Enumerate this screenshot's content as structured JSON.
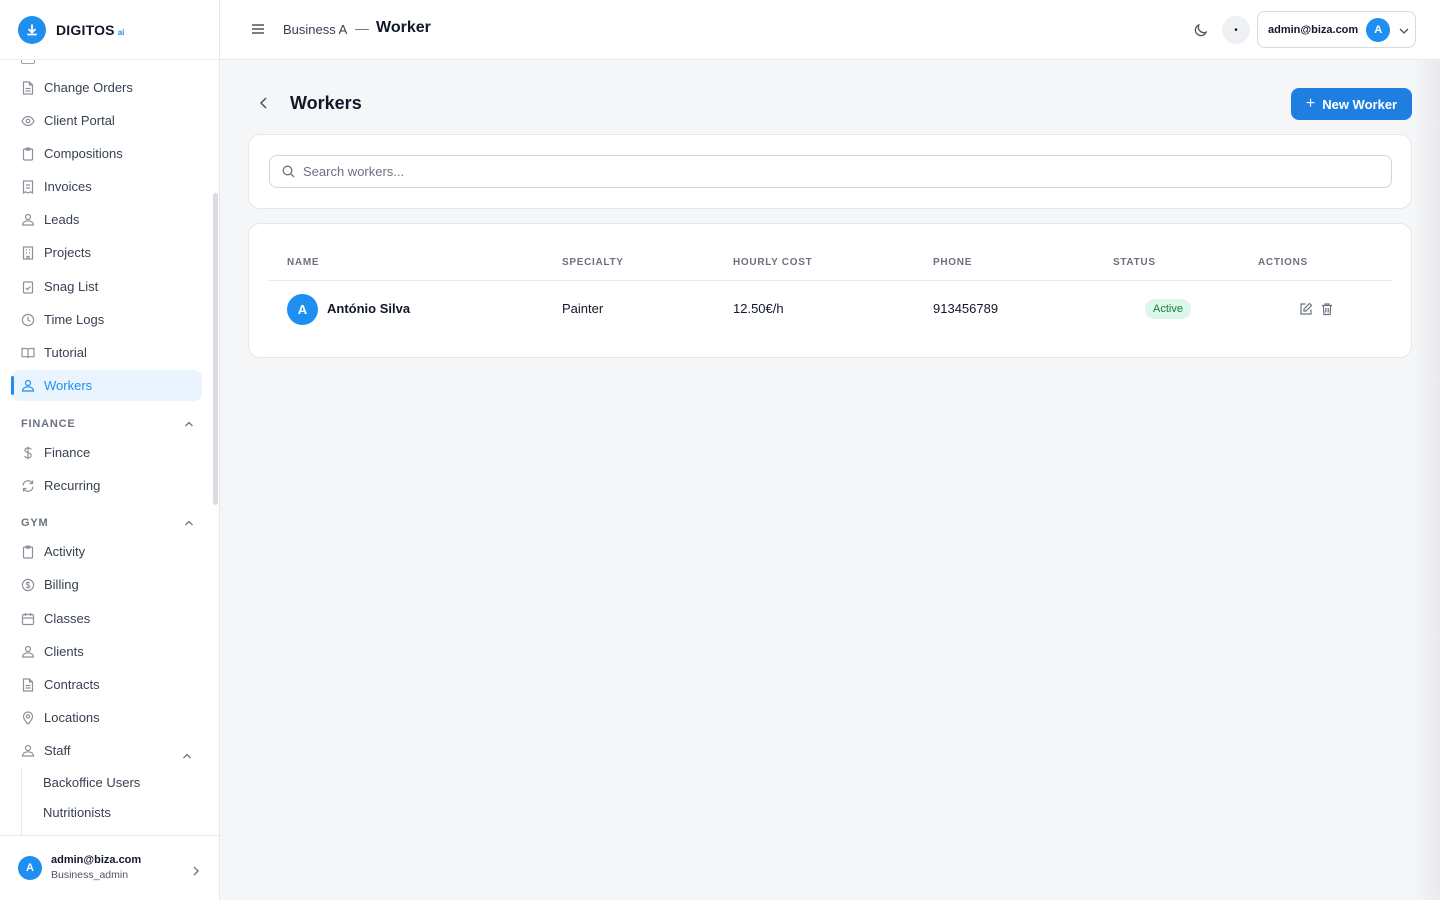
{
  "brand": {
    "name": "DIGITOS",
    "suffix": "ai"
  },
  "sidebar": {
    "items": [
      {
        "label": "Change Orders",
        "icon": "document-icon"
      },
      {
        "label": "Client Portal",
        "icon": "eye-icon"
      },
      {
        "label": "Compositions",
        "icon": "clipboard-icon"
      },
      {
        "label": "Invoices",
        "icon": "receipt-icon"
      },
      {
        "label": "Leads",
        "icon": "users-icon"
      },
      {
        "label": "Projects",
        "icon": "building-icon"
      },
      {
        "label": "Snag List",
        "icon": "clipboard-check-icon"
      },
      {
        "label": "Time Logs",
        "icon": "clock-icon"
      },
      {
        "label": "Tutorial",
        "icon": "book-icon"
      },
      {
        "label": "Workers",
        "icon": "users-icon",
        "active": true
      }
    ],
    "finance": {
      "heading": "FINANCE",
      "items": [
        {
          "label": "Finance",
          "icon": "dollar-icon"
        },
        {
          "label": "Recurring",
          "icon": "refresh-icon"
        }
      ]
    },
    "gym": {
      "heading": "GYM",
      "items": [
        {
          "label": "Activity",
          "icon": "clipboard-icon"
        },
        {
          "label": "Billing",
          "icon": "coin-icon"
        },
        {
          "label": "Classes",
          "icon": "calendar-icon"
        },
        {
          "label": "Clients",
          "icon": "users-icon"
        },
        {
          "label": "Contracts",
          "icon": "document-icon"
        },
        {
          "label": "Locations",
          "icon": "map-pin-icon"
        },
        {
          "label": "Staff",
          "icon": "users-icon"
        }
      ],
      "staff_sub": [
        "Backoffice Users",
        "Nutritionists"
      ]
    },
    "footer": {
      "email": "admin@biza.com",
      "role": "Business_admin",
      "avatar": "A"
    }
  },
  "header": {
    "business": "Business A",
    "separator": "—",
    "title": "Worker",
    "user_email": "admin@biza.com",
    "avatar": "A",
    "dot": "•"
  },
  "page": {
    "title": "Workers",
    "new_button": "New Worker",
    "search_placeholder": "Search workers..."
  },
  "table": {
    "columns": [
      "NAME",
      "SPECIALTY",
      "HOURLY COST",
      "PHONE",
      "STATUS",
      "ACTIONS"
    ],
    "rows": [
      {
        "initial": "A",
        "name": "António Silva",
        "specialty": "Painter",
        "hourly_cost": "12.50€/h",
        "phone": "913456789",
        "status": "Active"
      }
    ]
  },
  "colors": {
    "accent": "#1e8ff0",
    "button": "#1e7fe0",
    "status_active_bg": "#dcf6e7",
    "status_active_fg": "#15803d"
  }
}
